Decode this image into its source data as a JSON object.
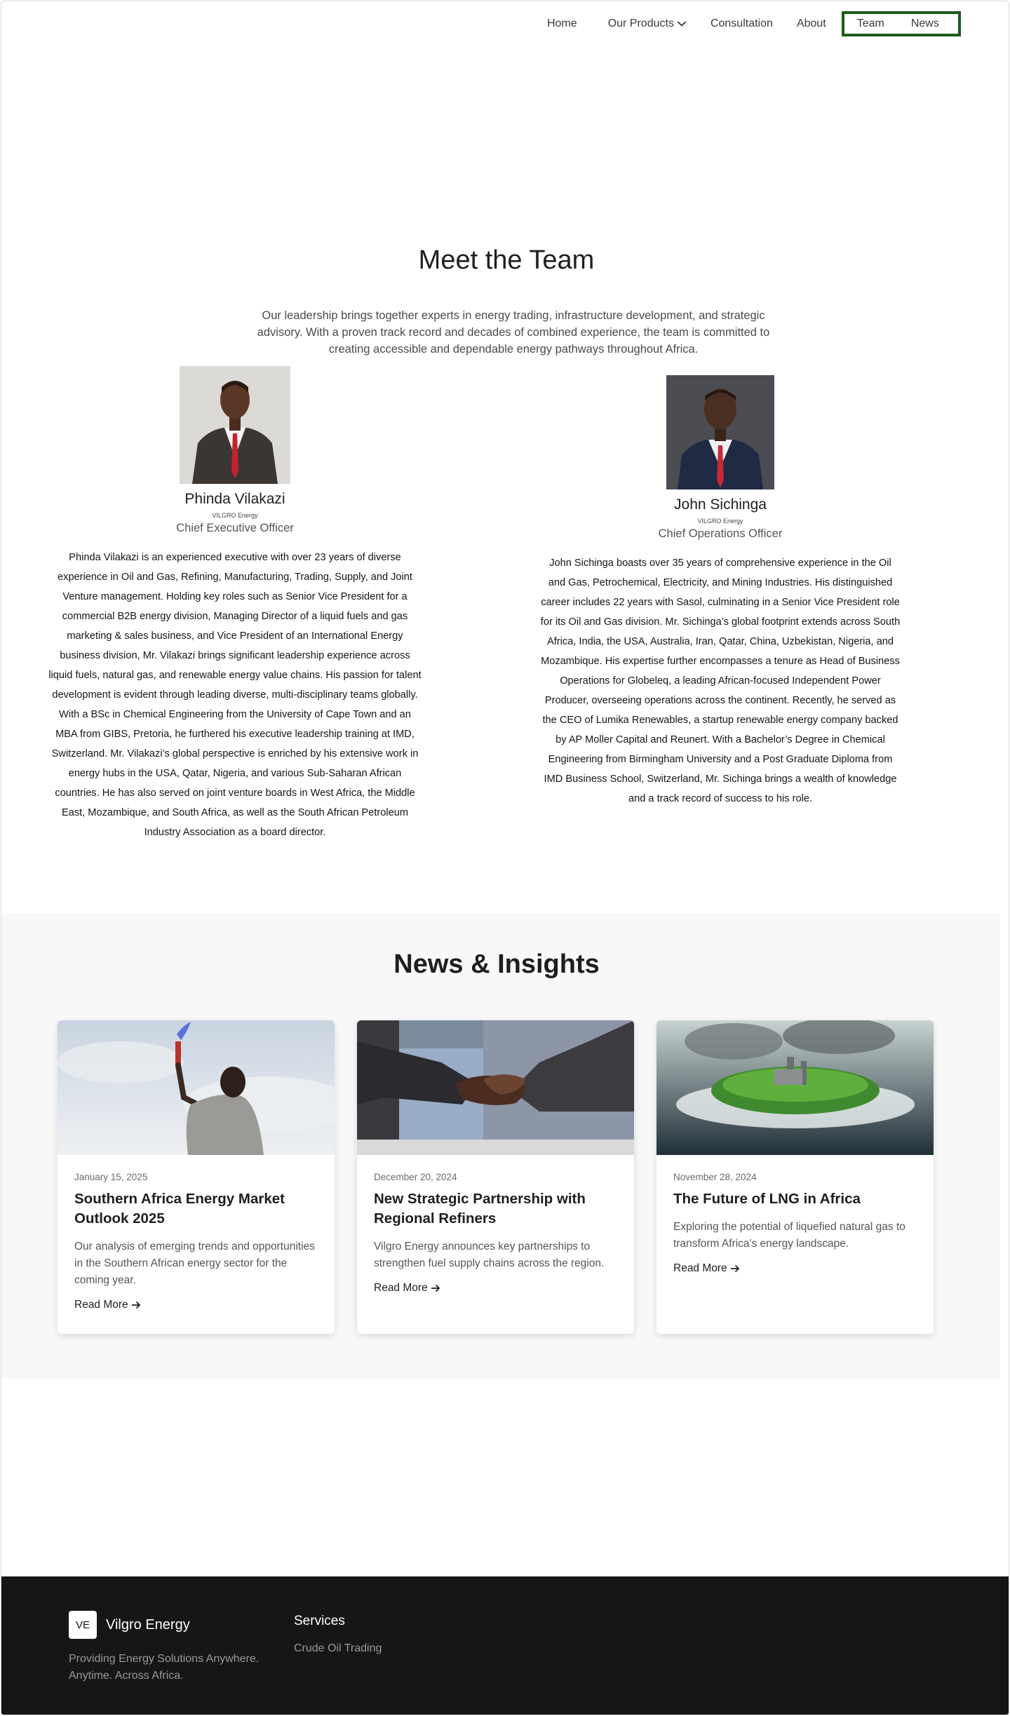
{
  "nav": {
    "home": "Home",
    "products": "Our Products",
    "consultation": "Consultation",
    "about": "About",
    "team": "Team",
    "news": "News",
    "highlight_color": "#1e5b1e"
  },
  "team": {
    "title": "Meet the Team",
    "intro": "Our leadership brings together experts in energy trading, infrastructure development, and strategic advisory. With a proven track record and decades of combined experience, the team is committed to creating accessible and dependable energy pathways throughout Africa.",
    "members": [
      {
        "name": "Phinda Vilakazi",
        "org": "VILGRO Energy",
        "role": "Chief Executive Officer",
        "bio": "Phinda Vilakazi is an experienced executive with over 23 years of diverse experience in Oil and Gas, Refining, Manufacturing, Trading, Supply, and Joint Venture management. Holding key roles such as Senior Vice President for a commercial B2B energy division, Managing Director of a liquid fuels and gas marketing & sales business, and Vice President of an International Energy business division, Mr. Vilakazi brings significant leadership experience across liquid fuels, natural gas, and renewable energy value chains. His passion for talent development is evident through leading diverse, multi-disciplinary teams globally. With a BSc in Chemical Engineering from the University of Cape Town and an MBA from GIBS, Pretoria, he furthered his executive leadership training at IMD, Switzerland. Mr. Vilakazi’s global perspective is enriched by his extensive work in energy hubs in the USA, Qatar, Nigeria, and various Sub-Saharan African countries. He has also served on joint venture boards in West Africa, the Middle East, Mozambique, and South Africa, as well as the South African Petroleum Industry Association as a board director."
      },
      {
        "name": "John Sichinga",
        "org": "VILGRO Energy",
        "role": "Chief Operations Officer",
        "bio": "John Sichinga boasts over 35 years of comprehensive experience in the Oil and Gas, Petrochemical, Electricity, and Mining Industries. His distinguished career includes 22 years with Sasol, culminating in a Senior Vice President role for its Oil and Gas division. Mr. Sichinga’s global footprint extends across South Africa, India, the USA, Australia, Iran, Qatar, China, Uzbekistan, Nigeria, and Mozambique. His expertise further encompasses a tenure as Head of Business Operations for Globeleq, a leading African-focused Independent Power Producer, overseeing operations across the continent. Recently, he served as the CEO of Lumika Renewables, a startup renewable energy company backed by AP Moller Capital and Reunert. With a Bachelor’s Degree in Chemical Engineering from Birmingham University and a Post Graduate Diploma from IMD Business School, Switzerland, Mr. Sichinga brings a wealth of knowledge and a track record of success to his role."
      }
    ]
  },
  "news": {
    "title": "News & Insights",
    "read_more": "Read More",
    "cards": [
      {
        "date": "January 15, 2025",
        "title": "Southern Africa Energy Market Outlook 2025",
        "excerpt": "Our analysis of emerging trends and opportunities in the Southern African energy sector for the coming year."
      },
      {
        "date": "December 20, 2024",
        "title": "New Strategic Partnership with Regional Refiners",
        "excerpt": "Vilgro Energy announces key partnerships to strengthen fuel supply chains across the region."
      },
      {
        "date": "November 28, 2024",
        "title": "The Future of LNG in Africa",
        "excerpt": "Exploring the potential of liquefied natural gas to transform Africa's energy landscape."
      }
    ]
  },
  "footer": {
    "logo": "VE",
    "brand": "Vilgro Energy",
    "tagline": "Providing Energy Solutions Anywhere. Anytime. Across Africa.",
    "services_heading": "Services",
    "services": [
      "Crude Oil Trading"
    ]
  }
}
